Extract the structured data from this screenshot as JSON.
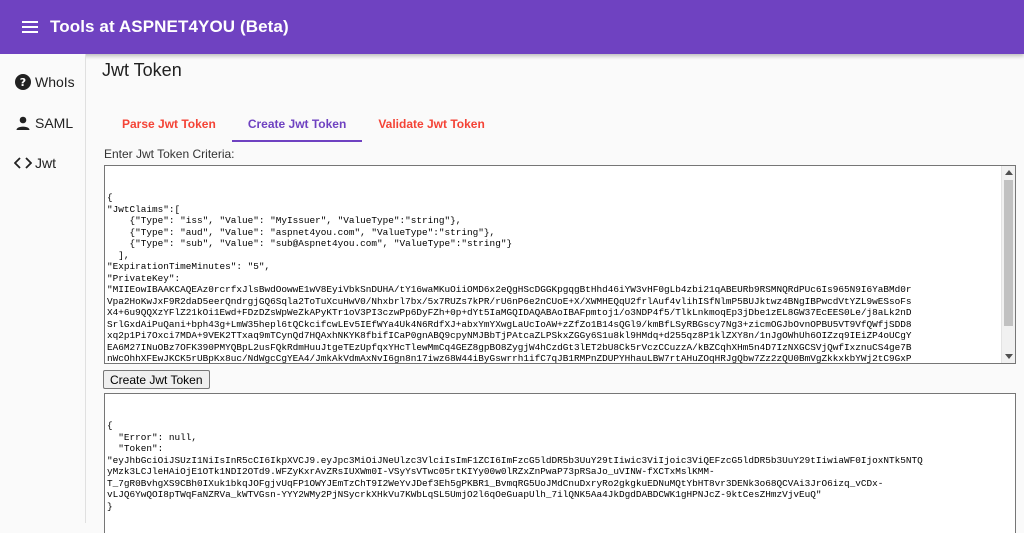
{
  "app": {
    "title": "Tools at ASPNET4YOU (Beta)"
  },
  "sidebar": {
    "items": [
      {
        "label": "WhoIs",
        "icon": "help-circle-icon"
      },
      {
        "label": "SAML",
        "icon": "person-icon"
      },
      {
        "label": "Jwt",
        "icon": "code-icon"
      }
    ]
  },
  "page": {
    "title": "Jwt Token"
  },
  "tabs": [
    {
      "label": "Parse Jwt Token",
      "active": false
    },
    {
      "label": "Create Jwt Token",
      "active": true
    },
    {
      "label": "Validate Jwt Token",
      "active": false
    }
  ],
  "form": {
    "criteria_label": "Enter Jwt Token Criteria:",
    "input_text": "{\n\"JwtClaims\":[\n    {\"Type\": \"iss\", \"Value\": \"MyIssuer\", \"ValueType\":\"string\"},\n    {\"Type\": \"aud\", \"Value\": \"aspnet4you.com\", \"ValueType\":\"string\"},\n    {\"Type\": \"sub\", \"Value\": \"sub@Aspnet4you.com\", \"ValueType\":\"string\"}\n  ],\n\"ExpirationTimeMinutes\": \"5\",\n\"PrivateKey\":\n\"MIIEowIBAAKCAQEAz0rcrfxJlsBwdOowwE1wV8EyiVbkSnDUHA/tY16waMKuOiiOMD6x2eQgHScDGGKpgqgBtHhd46iYW3vHF0gLb4zbi21qABEURb9RSMNQRdPUc6Is965N9I6YaBMd0r\nVpa2HoKwJxF9R2daD5eerQndrgjGQ6Sqla2ToTuXcuHwV0/Nhxbrl7bx/5x7RUZs7kPR/rU6nP6e2nCUoE+X/XWMHEQqU2frlAuf4vlihISfNlmP5BUJktwz4BNgIBPwcdVtYZL9wESsoFs\nX4+6u9QQXzYFlZ21kOi1Ewd+FDzDZsWpWeZkAPyKTr1oV3PI3czwPp6DyFZh+0p+dYt5IaMGQIDAQABAoIBAFpmtoj1/o3NDP4f5/TlkLnkmoqEp3jDbe1zEL8GW37EcEES0Le/j8aLk2nD\nSrlGxdAiPuQani+bph43g+LmW35hepl6tQCkcifcwLEv5IEfWYa4Uk4N6RdfXJ+abxYmYXwgLaUcIoAW+zZfZo1B14sQGl9/kmBfLSyRBGscy7Ng3+zicmOGJbOvnOPBU5VT9VfQWfjSDD8\nxq2p1Pi7Oxci7MDA+9VEK2TTxaq9mTCynQd7HQAxhNKYK8fbifICaP0gnABQ9cpyNMJBbTjPAtcaZLPSkxZGGy6S1u8kl9HMdq+d255qz8P1klZXY8n/1nJgOWhUh6OIZzq9IEiZP4oUCgY\nEA6M27INuOBz7OFK390PMYQBpL2usFQkRdmHuuJtgeTEzUpfqxYHcTlewMmCq4GEZ8gpBO8ZygjW4hCzdGt3lET2bU8Ck5rVczCCuzzA/kBZCqhXHm5n4D7IzNXGCSVjQwfIxznuCS4ge7B\nnWcOhhXFEwJKCK5rUBpKx8uc/NdWgcCgYEA4/JmkAkVdmAxNvI6gn8n17iwz68W44iByGswrrh1ifC7qJB1RMPnZDUPYHhauLBW7rtAHuZOqHRJgQbw7Zz2zQU0BmVgZkkxkbYWj2tC9GxP"
  },
  "buttons": {
    "create_label": "Create Jwt Token"
  },
  "output": {
    "text": "{\n  \"Error\": null,\n  \"Token\":\n\"eyJhbGciOiJSUzI1NiIsInR5cCI6IkpXVCJ9.eyJpc3MiOiJNeUlzc3VlciIsImF1ZCI6ImFzcG5ldDR5b3UuY29tIiwic3ViIjoic3ViQEFzcG5ldDR5b3UuY29tIiwiaWF0IjoxNTk5NTQ\nyMzk3LCJleHAiOjE1OTk1NDI2OTd9.WFZyKxrAvZRsIUXWm0I-VSyYsVTwc05rtKIYy00w0lRZxZnPwaP73pRSaJo_uVINW-fXCTxMslKMM-\nT_7gR0BvhgXS9CBh0IXuk1bkqJOFgjvUqFP1OWYJEmTzChT9I2WeYvJDef3Eh5gPKBR1_BvmqRG5UoJMdCnuDxryRo2gkgkuEDNuMQtYbHT8vr3DENk3o68QCVAi3JrO6izq_vCDx-\nvLJQ6YwQOI8pTWqFaNZRVa_kWTVGsn-YYY2WMy2PjNSycrkXHkVu7KWbLqSL5UmjO2l6qOeGuapUlh_7ilQNK5Aa4JkDgdDABDCWK1gHPNJcZ-9ktCesZHmzVjvEuQ\"\n}"
  },
  "colors": {
    "primary": "#6f42c1",
    "tab_inactive": "#f44336"
  }
}
